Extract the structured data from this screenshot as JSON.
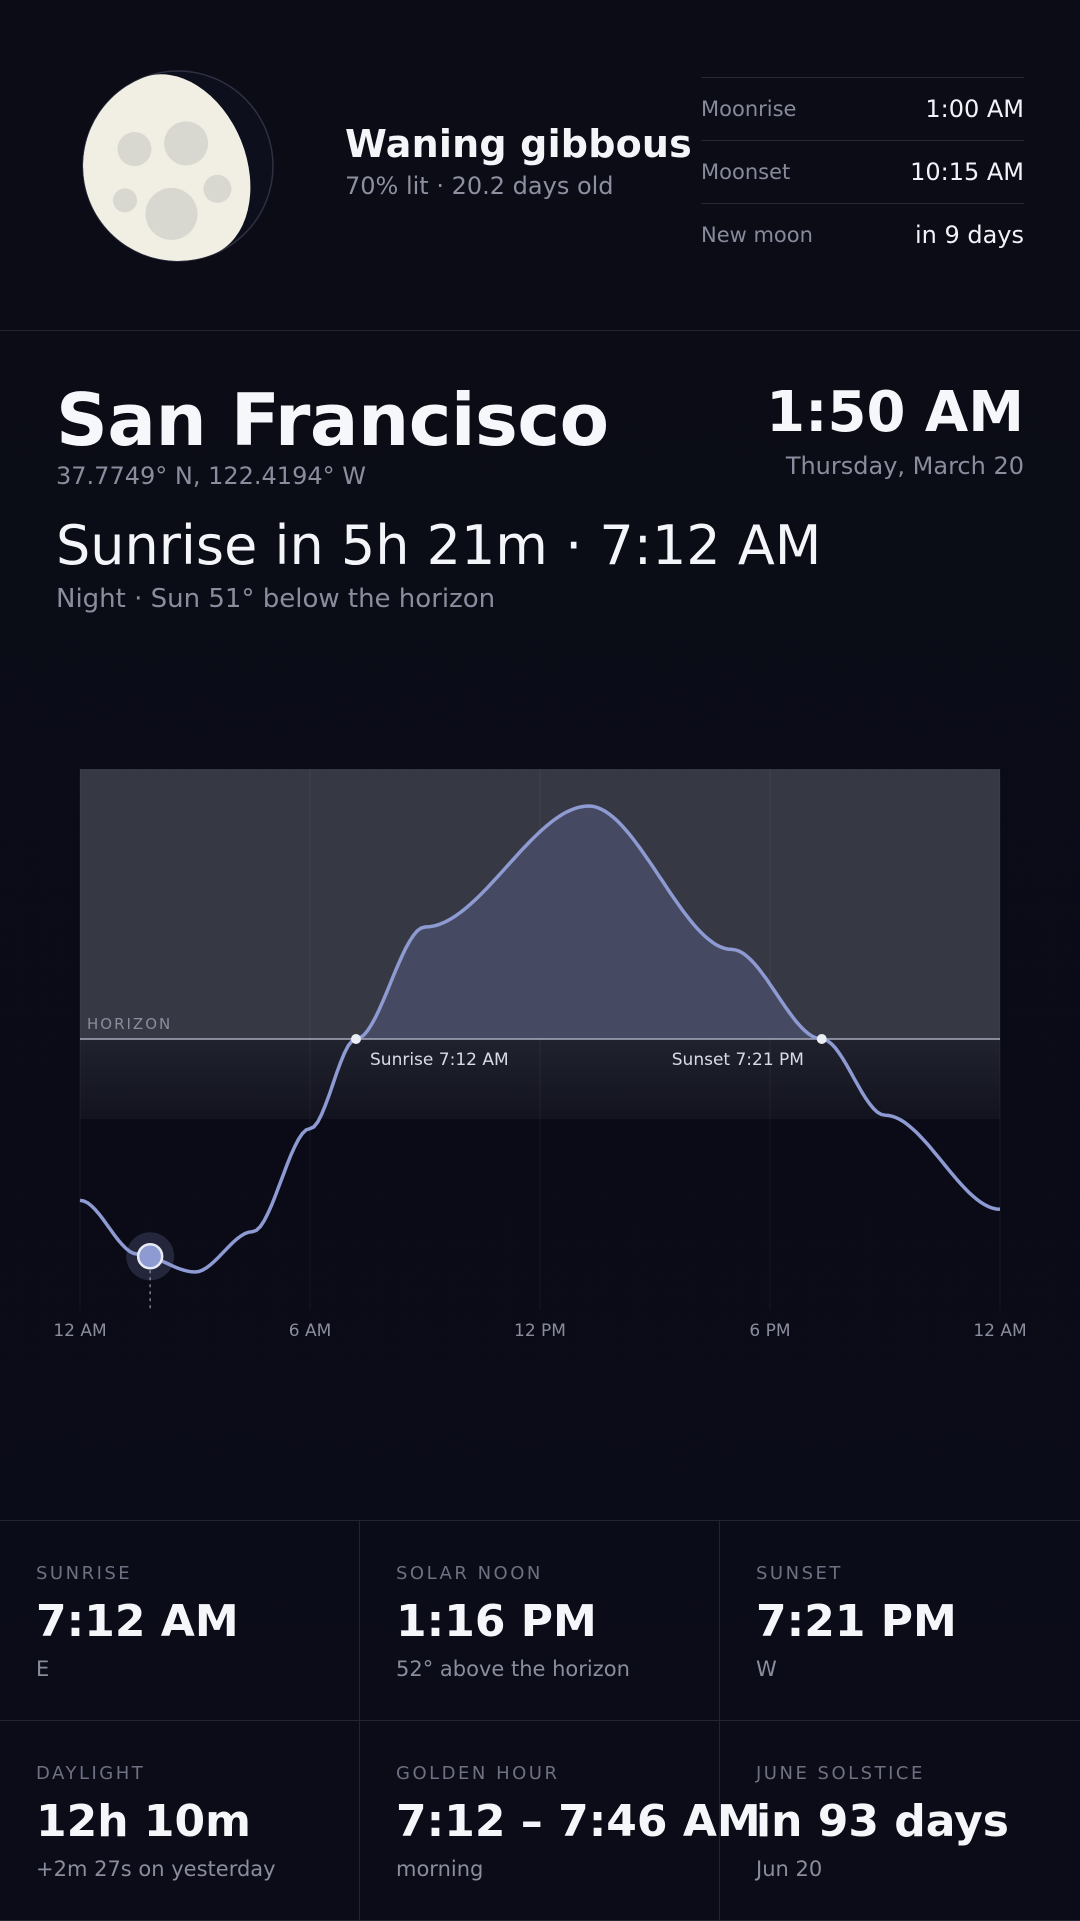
{
  "moon": {
    "phase": "Waning gibbous",
    "detail": "70% lit · 20.2 days old",
    "rows": [
      {
        "label": "Moonrise",
        "value": "1:00 AM"
      },
      {
        "label": "Moonset",
        "value": "10:15 AM"
      },
      {
        "label": "New moon",
        "value": "in 9 days"
      }
    ]
  },
  "location": {
    "city": "San Francisco",
    "coords": "37.7749° N, 122.4194° W",
    "time": "1:50 AM",
    "date": "Thursday, March 20"
  },
  "status": {
    "headline": "Sunrise in 5h 21m · 7:12 AM",
    "subline": "Night · Sun 51° below the horizon"
  },
  "chart_data": {
    "type": "area",
    "series": [
      {
        "x_hours": [
          0,
          1.5,
          3,
          4.5,
          6,
          7.2,
          9,
          13.27,
          17,
          19.35,
          21,
          24
        ],
        "altitude_deg": [
          -36,
          -48,
          -52,
          -43,
          -20,
          0,
          25,
          52,
          20,
          0,
          -17,
          -38
        ]
      }
    ],
    "xlim": [
      0,
      24
    ],
    "x_ticks": [
      "12 AM",
      "6 AM",
      "12 PM",
      "6 PM",
      "12 AM"
    ],
    "horizon_label": "HORIZON",
    "sunrise_label": "Sunrise 7:12 AM",
    "sunset_label": "Sunset 7:21 PM",
    "current_hour": 1.83,
    "line_color": "#8e9ad2",
    "fill_color": "#454a62"
  },
  "stats": [
    {
      "label": "SUNRISE",
      "value": "7:12 AM",
      "note": "E"
    },
    {
      "label": "SOLAR NOON",
      "value": "1:16 PM",
      "note": "52° above the horizon"
    },
    {
      "label": "SUNSET",
      "value": "7:21 PM",
      "note": "W"
    },
    {
      "label": "DAYLIGHT",
      "value": "12h 10m",
      "note": "+2m 27s on yesterday"
    },
    {
      "label": "GOLDEN HOUR",
      "value": "7:12 – 7:46 AM",
      "note": "morning"
    },
    {
      "label": "JUNE SOLSTICE",
      "value": "in 93 days",
      "note": "Jun 20"
    }
  ]
}
